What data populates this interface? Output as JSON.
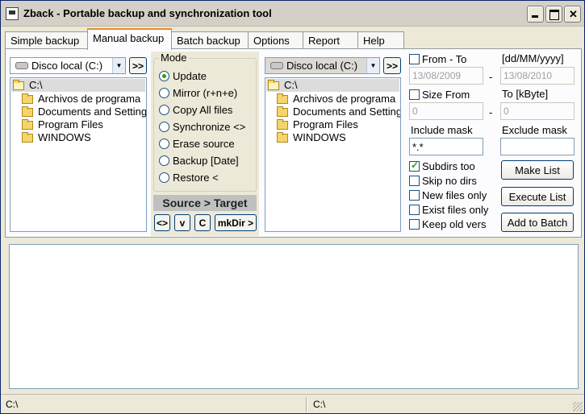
{
  "window": {
    "title": "Zback - Portable backup and synchronization tool"
  },
  "tabs": [
    "Simple backup",
    "Manual backup",
    "Batch backup",
    "Options",
    "Report",
    "Help"
  ],
  "source": {
    "drive": "Disco local (C:)",
    "go_label": ">>",
    "tree": [
      "C:\\",
      "Archivos de programa",
      "Documents and Settings",
      "Program Files",
      "WINDOWS"
    ]
  },
  "target": {
    "drive": "Disco local (C:)",
    "go_label": ">>",
    "tree": [
      "C:\\",
      "Archivos de programa",
      "Documents and Settings",
      "Program Files",
      "WINDOWS"
    ]
  },
  "mode": {
    "title": "Mode",
    "options": [
      "Update",
      "Mirror (r+n+e)",
      "Copy All files",
      "Synchronize <>",
      "Erase source",
      "Backup [Date]",
      "Restore <"
    ],
    "selected": "Update",
    "direction_label": "Source > Target",
    "buttons": [
      "<>",
      "v",
      "C",
      "mkDir >"
    ]
  },
  "filters": {
    "from_to_label": "From  - To",
    "date_format": "[dd/MM/yyyy]",
    "date_from": "13/08/2009",
    "date_to": "13/08/2010",
    "dash": "-",
    "size_label": "Size  From",
    "to_kbyte_label": "To [kByte]",
    "size_from": "0",
    "size_to": "0",
    "include_label": "Include mask",
    "include_value": "*.*",
    "exclude_label": "Exclude mask",
    "exclude_value": ""
  },
  "checkboxes": [
    {
      "label": "Subdirs too",
      "checked": true
    },
    {
      "label": "Skip no dirs",
      "checked": false
    },
    {
      "label": "New files only",
      "checked": false
    },
    {
      "label": "Exist files only",
      "checked": false
    },
    {
      "label": "Keep old vers",
      "checked": false
    }
  ],
  "actions": {
    "make_list": "Make List",
    "execute_list": "Execute List",
    "add_to_batch": "Add to Batch"
  },
  "status": {
    "left": "C:\\",
    "right": "C:\\"
  }
}
